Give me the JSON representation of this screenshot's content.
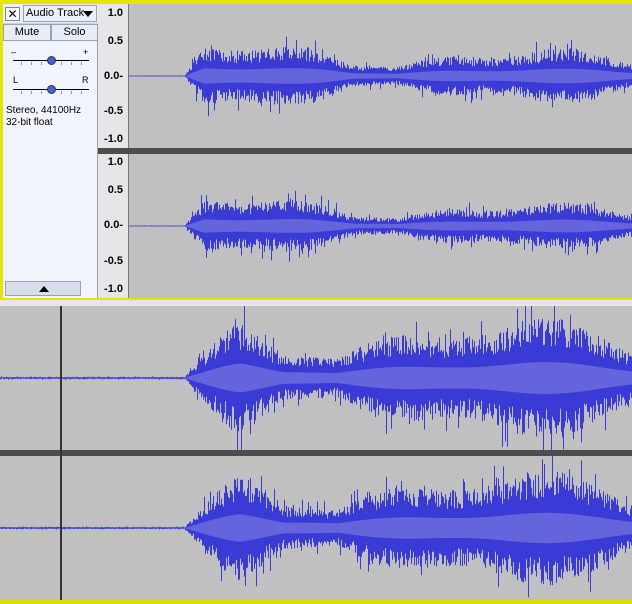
{
  "track1": {
    "close_symbol": "✕",
    "name": "Audio Track",
    "mute_label": "Mute",
    "solo_label": "Solo",
    "gain_minus": "–",
    "gain_plus": "+",
    "pan_left": "L",
    "pan_right": "R",
    "info_line1": "Stereo, 44100Hz",
    "info_line2": "32-bit float",
    "gain_level": 0.5,
    "pan_level": 0.5,
    "ruler_labels": [
      "1.0",
      "0.5",
      "0.0-",
      "-0.5",
      "-1.0"
    ]
  },
  "colors": {
    "track_selected_border": "#e5e500",
    "wave_background": "#c0c0c0",
    "wave_peak": "#3a3ad6",
    "wave_rms": "#6464dc",
    "panel_background": "#f1f4fb"
  },
  "icons": {
    "close": "close-icon",
    "menu": "dropdown-arrow-icon",
    "collapse": "collapse-arrow-icon"
  }
}
